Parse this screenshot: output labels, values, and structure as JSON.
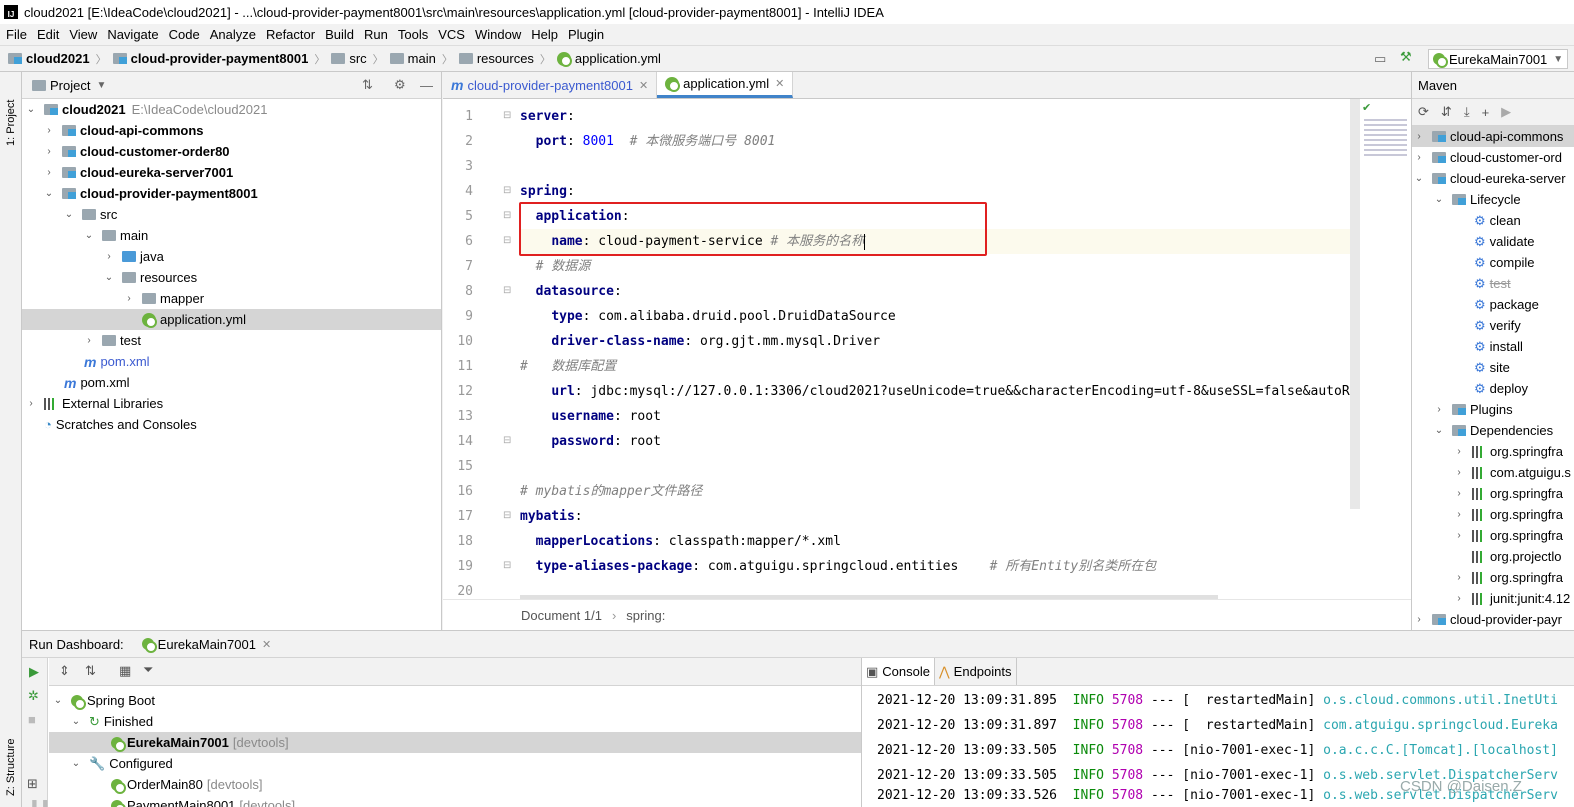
{
  "window": {
    "title": "cloud2021 [E:\\IdeaCode\\cloud2021] - ...\\cloud-provider-payment8001\\src\\main\\resources\\application.yml [cloud-provider-payment8001] - IntelliJ IDEA",
    "logo": "IJ"
  },
  "menu": [
    "File",
    "Edit",
    "View",
    "Navigate",
    "Code",
    "Analyze",
    "Refactor",
    "Build",
    "Run",
    "Tools",
    "VCS",
    "Window",
    "Help",
    "Plugin"
  ],
  "breadcrumbs": [
    "cloud2021",
    "cloud-provider-payment8001",
    "src",
    "main",
    "resources",
    "application.yml"
  ],
  "run_config": "EurekaMain7001",
  "side_tabs": {
    "project": "1: Project",
    "structure": "Z: Structure"
  },
  "project": {
    "header": "Project",
    "tree": [
      {
        "label": "cloud2021",
        "hint": "E:\\IdeaCode\\cloud2021",
        "arrow": "v"
      },
      {
        "label": "cloud-api-commons",
        "arrow": ">"
      },
      {
        "label": "cloud-customer-order80",
        "arrow": ">"
      },
      {
        "label": "cloud-eureka-server7001",
        "arrow": ">"
      },
      {
        "label": "cloud-provider-payment8001",
        "arrow": "v"
      },
      {
        "label": "src",
        "arrow": "v"
      },
      {
        "label": "main",
        "arrow": "v"
      },
      {
        "label": "java",
        "arrow": ">"
      },
      {
        "label": "resources",
        "arrow": "v"
      },
      {
        "label": "mapper",
        "arrow": ">"
      },
      {
        "label": "application.yml",
        "arrow": ""
      },
      {
        "label": "test",
        "arrow": ">"
      },
      {
        "label": "pom.xml",
        "arrow": ""
      },
      {
        "label": "pom.xml",
        "arrow": ""
      },
      {
        "label": "External Libraries",
        "arrow": ">"
      },
      {
        "label": "Scratches and Consoles",
        "arrow": ""
      }
    ]
  },
  "editor": {
    "tabs": [
      {
        "label": "cloud-provider-payment8001"
      },
      {
        "label": "application.yml"
      }
    ],
    "line_numbers": [
      "1",
      "2",
      "3",
      "4",
      "5",
      "6",
      "7",
      "8",
      "9",
      "10",
      "11",
      "12",
      "13",
      "14",
      "15",
      "16",
      "17",
      "18",
      "19",
      "20"
    ],
    "lines": {
      "l1_key": "server",
      "l2_key": "port",
      "l2_val": "8001",
      "l2_cm": "# 本微服务端口号 8001",
      "l4_key": "spring",
      "l5_key": "application",
      "l6_key": "name",
      "l6_val": "cloud-payment-service",
      "l6_cm": "# 本服务的名称",
      "l7_cm": "# 数据源",
      "l8_key": "datasource",
      "l9_key": "type",
      "l9_val": "com.alibaba.druid.pool.DruidDataSource",
      "l10_key": "driver-class-name",
      "l10_val": "org.gjt.mm.mysql.Driver",
      "l11_cm": "#   数据库配置",
      "l12_key": "url",
      "l12_val": "jdbc:mysql://127.0.0.1:3306/cloud2021?useUnicode=true&&characterEncoding=utf-8&useSSL=false&autoR",
      "l13_key": "username",
      "l13_val": "root",
      "l14_key": "password",
      "l14_val": "root",
      "l16_cm": "# mybatis的mapper文件路径",
      "l17_key": "mybatis",
      "l18_key": "mapperLocations",
      "l18_val": "classpath:mapper/*.xml",
      "l19_key": "type-aliases-package",
      "l19_val": "com.atguigu.springcloud.entities",
      "l19_cm": "# 所有Entity别名类所在包"
    },
    "status": {
      "doc": "Document 1/1",
      "sep": "›",
      "path": "spring:"
    }
  },
  "maven": {
    "header": "Maven",
    "tree": [
      {
        "label": "cloud-api-commons",
        "arrow": ">"
      },
      {
        "label": "cloud-customer-ord",
        "arrow": ">"
      },
      {
        "label": "cloud-eureka-server",
        "arrow": "v"
      },
      {
        "label": "Lifecycle",
        "arrow": "v"
      },
      {
        "label": "clean"
      },
      {
        "label": "validate"
      },
      {
        "label": "compile"
      },
      {
        "label": "test"
      },
      {
        "label": "package"
      },
      {
        "label": "verify"
      },
      {
        "label": "install"
      },
      {
        "label": "site"
      },
      {
        "label": "deploy"
      },
      {
        "label": "Plugins",
        "arrow": ">"
      },
      {
        "label": "Dependencies",
        "arrow": "v"
      },
      {
        "label": "org.springfra",
        "arrow": ">"
      },
      {
        "label": "com.atguigu.s",
        "arrow": ">"
      },
      {
        "label": "org.springfra",
        "arrow": ">"
      },
      {
        "label": "org.springfra",
        "arrow": ">"
      },
      {
        "label": "org.springfra",
        "arrow": ">"
      },
      {
        "label": "org.projectlo",
        "arrow": ""
      },
      {
        "label": "org.springfra",
        "arrow": ">"
      },
      {
        "label": "junit:junit:4.12",
        "arrow": ">"
      },
      {
        "label": "cloud-provider-payr",
        "arrow": ">"
      }
    ]
  },
  "run": {
    "header": "Run Dashboard:",
    "tab": "EurekaMain7001",
    "tree": [
      {
        "label": "Spring Boot",
        "arrow": "v"
      },
      {
        "label": "Finished",
        "arrow": "v"
      },
      {
        "label": "EurekaMain7001",
        "hint": "[devtools]"
      },
      {
        "label": "Configured",
        "arrow": "v"
      },
      {
        "label": "OrderMain80",
        "hint": "[devtools]"
      },
      {
        "label": "PaymentMain8001",
        "hint": "[devtools]"
      }
    ],
    "console_tabs": [
      "Console",
      "Endpoints"
    ],
    "logs": [
      {
        "ts": "2021-12-20 13:09:31.895",
        "level": "INFO",
        "pid": "5708",
        "sep": "---",
        "thread": "[  restartedMain]",
        "logger": "o.s.cloud.commons.util.InetUti"
      },
      {
        "ts": "2021-12-20 13:09:31.897",
        "level": "INFO",
        "pid": "5708",
        "sep": "---",
        "thread": "[  restartedMain]",
        "logger": "com.atguigu.springcloud.Eureka"
      },
      {
        "ts": "2021-12-20 13:09:33.505",
        "level": "INFO",
        "pid": "5708",
        "sep": "---",
        "thread": "[nio-7001-exec-1]",
        "logger": "o.a.c.c.C.[Tomcat].[localhost]"
      },
      {
        "ts": "2021-12-20 13:09:33.505",
        "level": "INFO",
        "pid": "5708",
        "sep": "---",
        "thread": "[nio-7001-exec-1]",
        "logger": "o.s.web.servlet.DispatcherServ"
      },
      {
        "ts": "2021-12-20 13:09:33.526",
        "level": "INFO",
        "pid": "5708",
        "sep": "---",
        "thread": "[nio-7001-exec-1]",
        "logger": "o.s.web.servlet.DispatcherServ"
      }
    ]
  },
  "watermark": "CSDN @Daisen.Z"
}
